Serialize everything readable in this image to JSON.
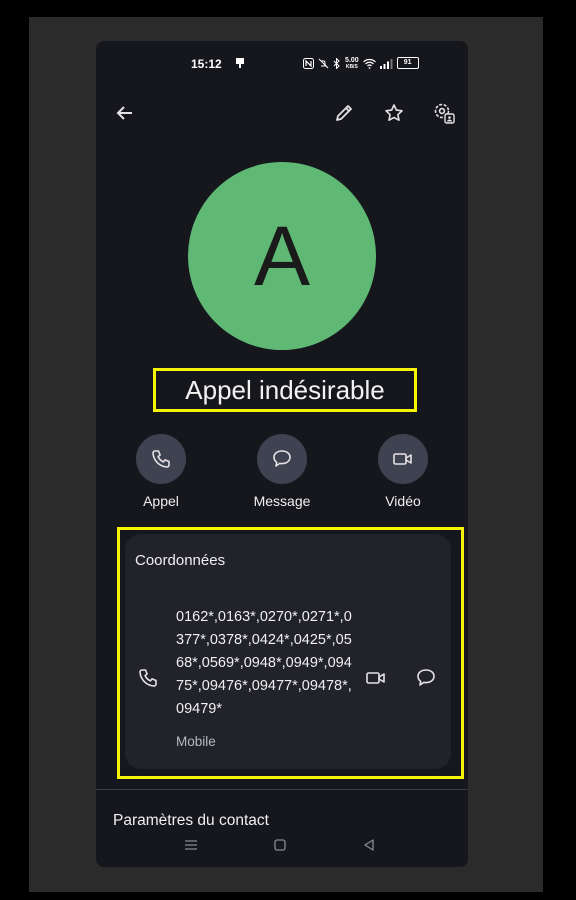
{
  "status_bar": {
    "time": "15:12",
    "net_speed_value": "5.00",
    "net_speed_unit": "KB/S",
    "battery": "91"
  },
  "toolbar": {
    "back_icon": "arrow-left-icon",
    "edit_icon": "pencil-icon",
    "favorite_icon": "star-icon",
    "settings_icon": "contact-settings-icon"
  },
  "contact": {
    "initial": "A",
    "name": "Appel indésirable",
    "avatar_color": "#5fb874"
  },
  "actions": [
    {
      "label": "Appel",
      "icon": "phone-icon"
    },
    {
      "label": "Message",
      "icon": "message-icon"
    },
    {
      "label": "Vidéo",
      "icon": "video-icon"
    }
  ],
  "details": {
    "title": "Coordonnées",
    "number": "0162*,0163*,0270*,0271*,0377*,0378*,0424*,0425*,0568*,0569*,0948*,0949*,09475*,09476*,09477*,09478*,09479*",
    "type": "Mobile"
  },
  "settings_label": "Paramètres du contact",
  "highlight_color": "#f5f500"
}
